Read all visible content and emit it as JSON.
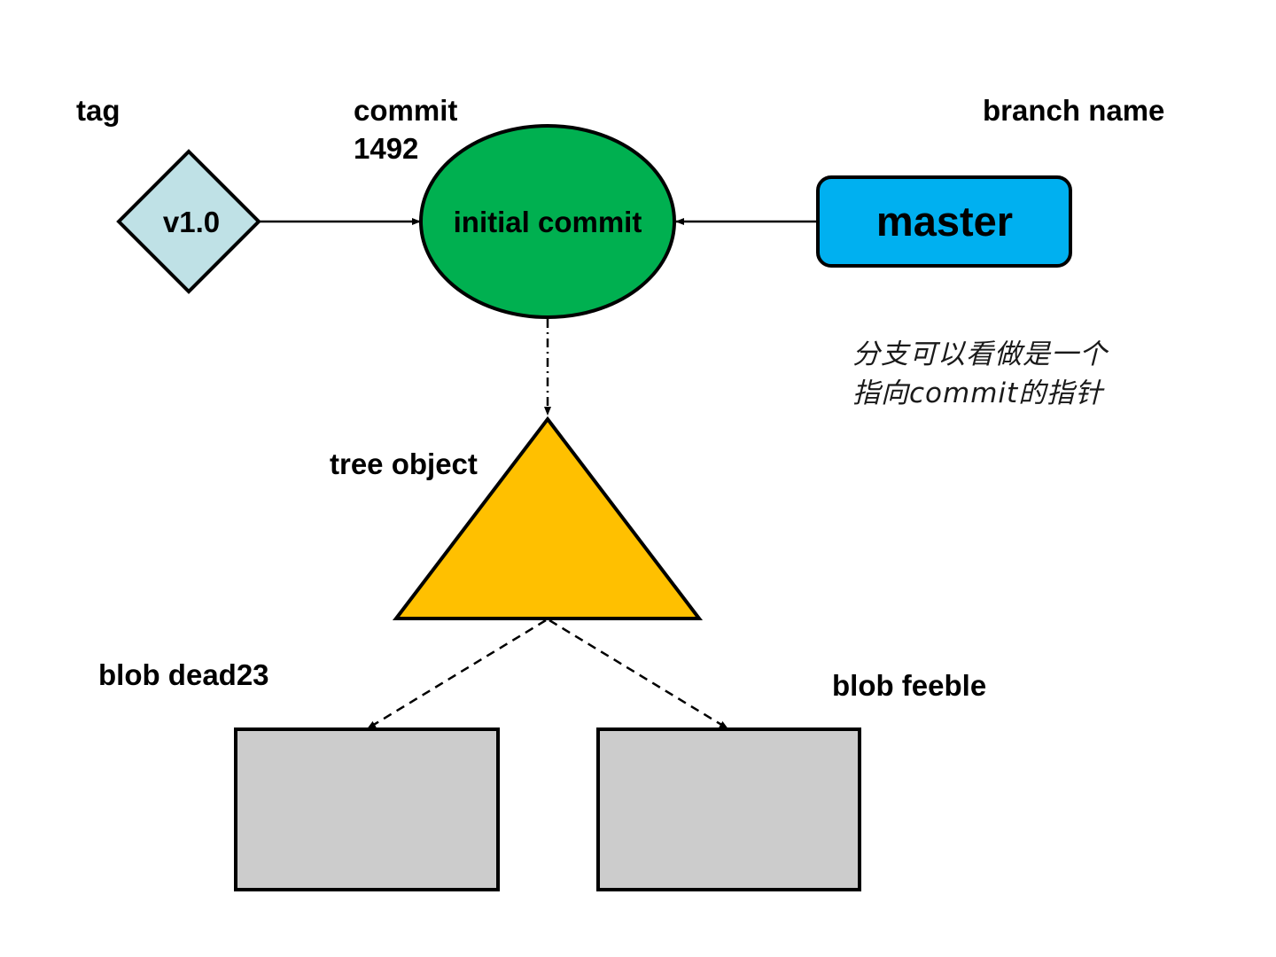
{
  "labels": {
    "tag": "tag",
    "commit_title": "commit",
    "commit_id": "1492",
    "branch_name": "branch name",
    "tree_object": "tree object",
    "blob_left": "blob dead23",
    "blob_right": "blob feeble"
  },
  "nodes": {
    "tag": "v1.0",
    "commit": "initial commit",
    "branch": "master"
  },
  "note": {
    "line1": "分支可以看做是一个",
    "line2": "指向commit的指针"
  },
  "colors": {
    "tag_fill": "#bfe1e6",
    "commit_fill": "#00b050",
    "branch_fill": "#00b0f0",
    "tree_fill": "#ffc000",
    "blob_fill": "#cccccc",
    "stroke": "#000000"
  }
}
